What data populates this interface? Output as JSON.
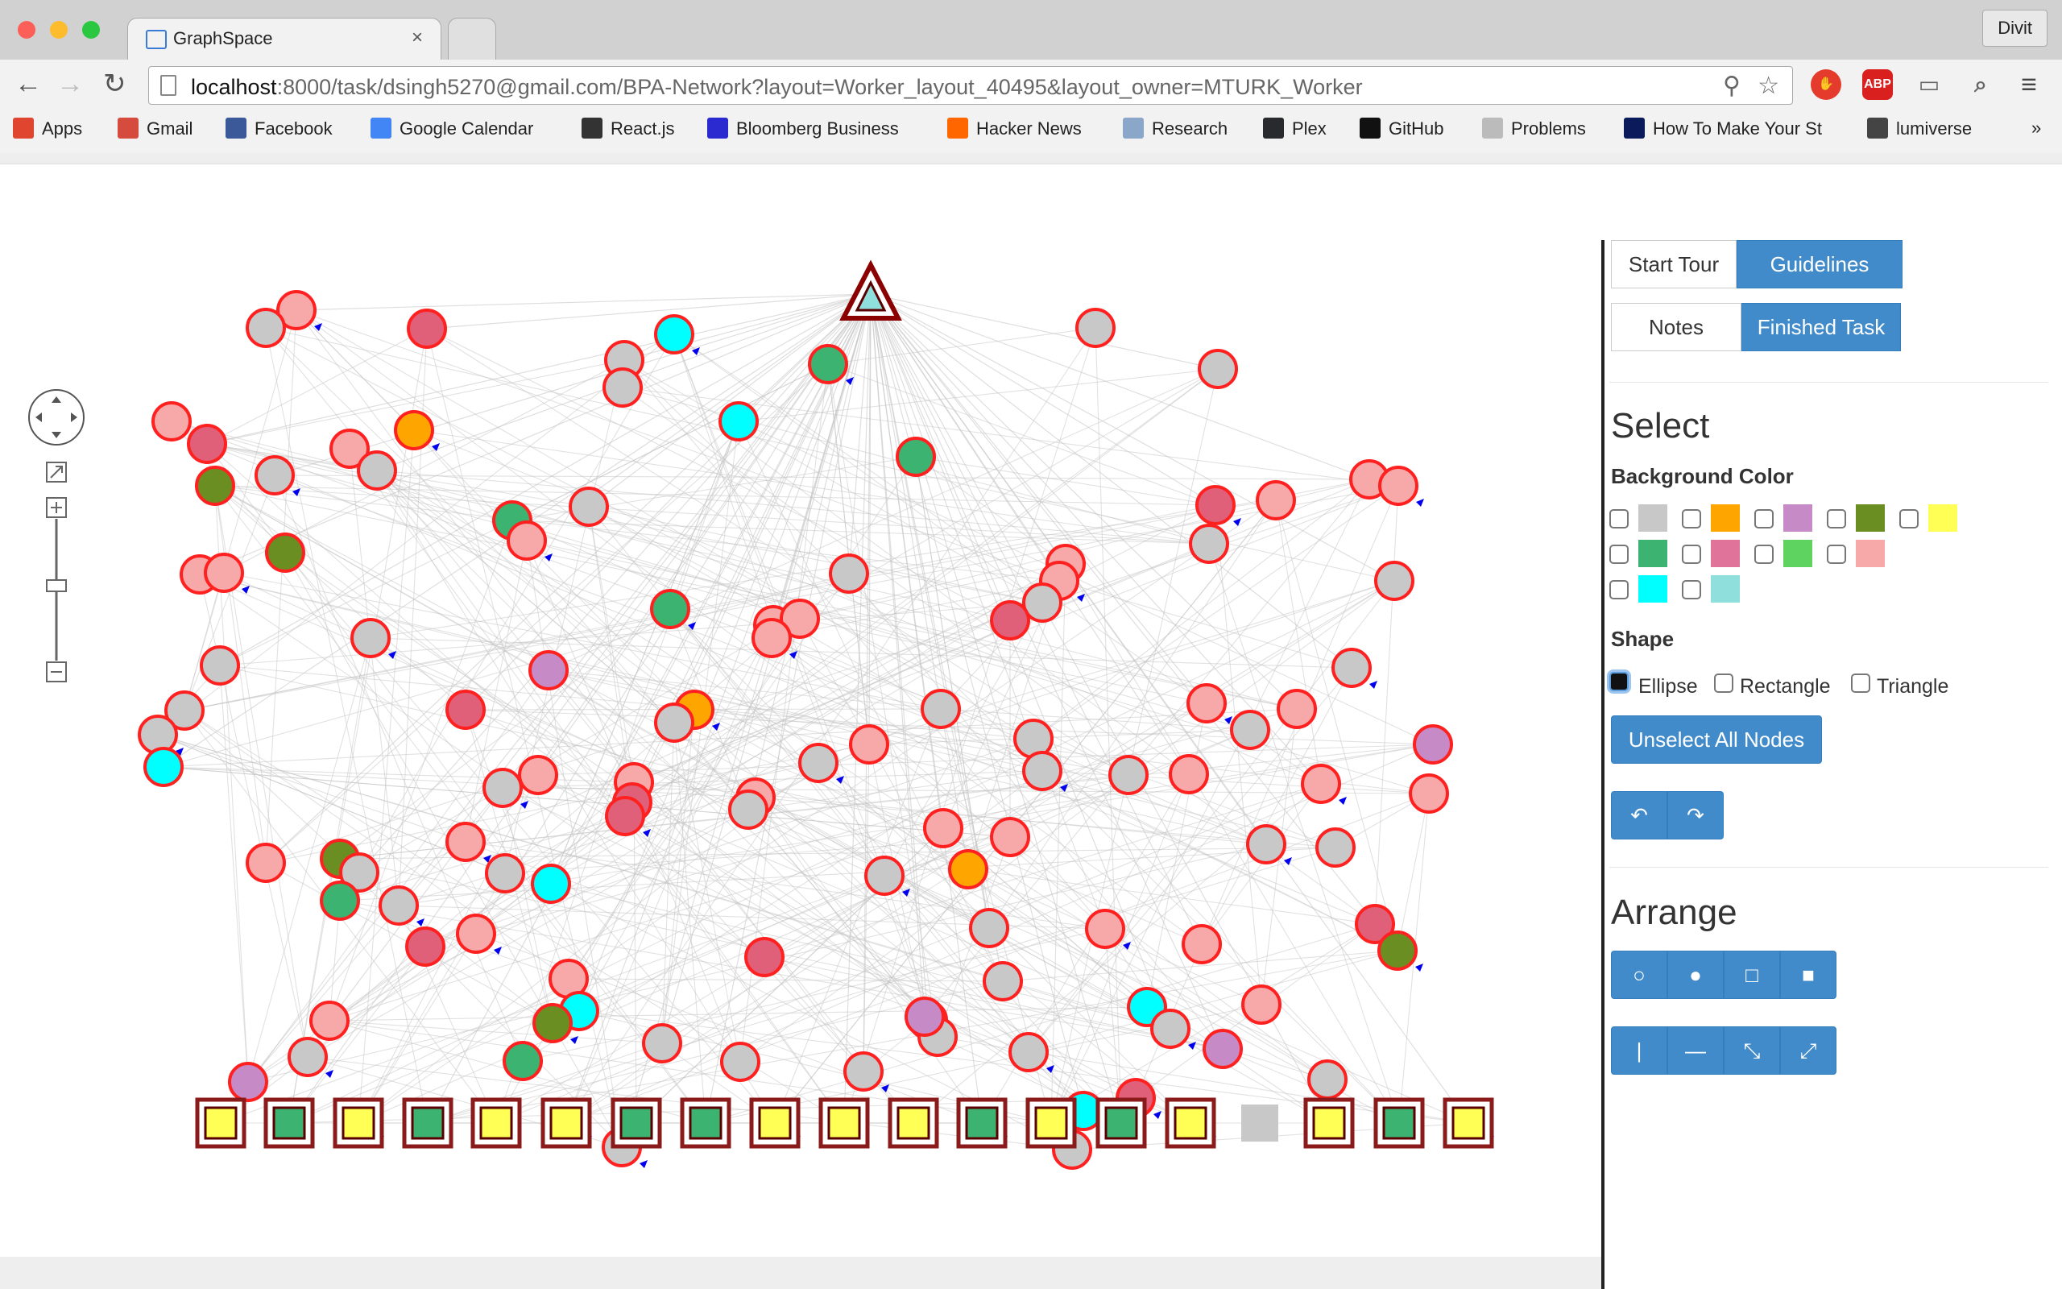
{
  "browser": {
    "tab_title": "GraphSpace",
    "tab_close": "×",
    "profile_name": "Divit",
    "url_host": "localhost",
    "url_rest": ":8000/task/dsingh5270@gmail.com/BPA-Network?layout=Worker_layout_40495&layout_owner=MTURK_Worker",
    "nav_back": "←",
    "nav_forward": "→",
    "nav_reload": "↻",
    "ext_abp": "ABP",
    "menu": "≡"
  },
  "bookmarks": [
    {
      "label": "Apps",
      "icon_color": "#e0452f"
    },
    {
      "label": "Gmail",
      "icon_color": "#d54b3d"
    },
    {
      "label": "Facebook",
      "icon_color": "#3b5998"
    },
    {
      "label": "Google Calendar",
      "icon_color": "#4285f4"
    },
    {
      "label": "React.js",
      "icon_color": "#333"
    },
    {
      "label": "Bloomberg Business",
      "icon_color": "#2a2ad0"
    },
    {
      "label": "Hacker News",
      "icon_color": "#ff6600"
    },
    {
      "label": "Research",
      "icon_color": "#8aa6c8"
    },
    {
      "label": "Plex",
      "icon_color": "#282a2d"
    },
    {
      "label": "GitHub",
      "icon_color": "#111"
    },
    {
      "label": "Problems",
      "icon_color": "#bbb"
    },
    {
      "label": "How To Make Your St",
      "icon_color": "#0a1a5a"
    },
    {
      "label": "lumiverse",
      "icon_color": "#444"
    }
  ],
  "bookmarks_more": "»",
  "sidebar": {
    "start_tour": "Start Tour",
    "guidelines": "Guidelines",
    "notes": "Notes",
    "finished_task": "Finished Task",
    "select_title": "Select",
    "background_color_label": "Background Color",
    "swatches": [
      "#c8c8c8",
      "#ffa500",
      "#c68bc6",
      "#6b8e23",
      "#ffff55",
      "#3cb371",
      "#e0739a",
      "#5fd35f",
      "#f7a8a8",
      "#00ffff",
      "#8fe0dc"
    ],
    "shape_label": "Shape",
    "shapes": [
      "Ellipse",
      "Rectangle",
      "Triangle"
    ],
    "unselect_all": "Unselect All Nodes",
    "undo": "↶",
    "redo": "↷",
    "arrange_title": "Arrange",
    "arrange_icons_1": [
      "○",
      "●",
      "□",
      "■"
    ],
    "arrange_icons_2": [
      "|",
      "—",
      "⤡",
      "⤢"
    ]
  },
  "colors": {
    "node_border": "#ff2020",
    "triangle_border": "#8b0000",
    "edge": "#c4c4c4",
    "arrow": "#0000ee",
    "square_border": "#8b1a1a",
    "primary": "#428bca"
  }
}
